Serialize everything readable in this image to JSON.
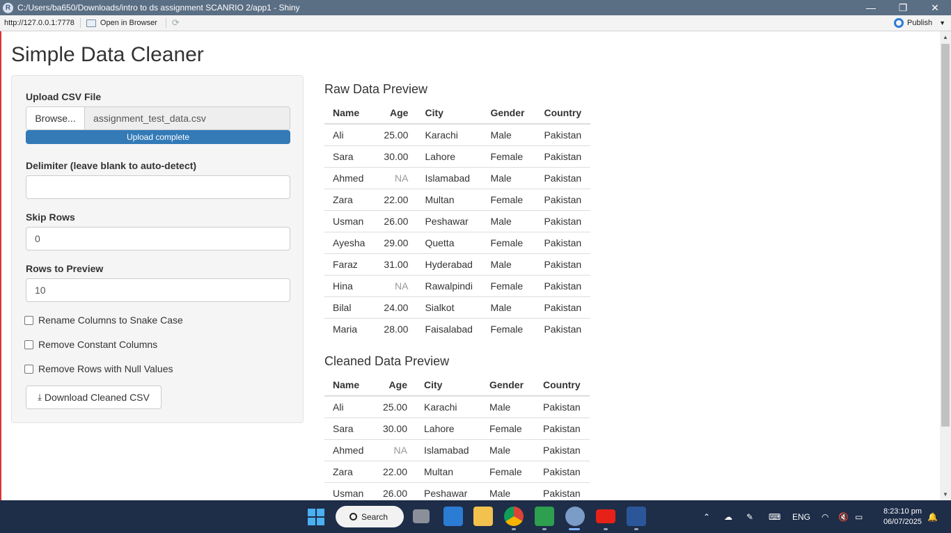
{
  "window": {
    "title": "C:/Users/ba650/Downloads/intro to ds assignment SCANRIO 2/app1 - Shiny",
    "app_icon": "R",
    "minimize": "—",
    "maximize": "❐",
    "close": "✕"
  },
  "toolbar": {
    "url": "http://127.0.0.1:7778",
    "open_in_browser": "Open in Browser",
    "publish": "Publish"
  },
  "page": {
    "title": "Simple Data Cleaner"
  },
  "sidebar": {
    "upload_label": "Upload CSV File",
    "browse_label": "Browse...",
    "file_name": "assignment_test_data.csv",
    "upload_status": "Upload complete",
    "delimiter_label": "Delimiter (leave blank to auto-detect)",
    "delimiter_value": "",
    "skip_rows_label": "Skip Rows",
    "skip_rows_value": "0",
    "rows_preview_label": "Rows to Preview",
    "rows_preview_value": "10",
    "checkboxes": [
      {
        "label": "Rename Columns to Snake Case",
        "checked": false
      },
      {
        "label": "Remove Constant Columns",
        "checked": false
      },
      {
        "label": "Remove Rows with Null Values",
        "checked": false
      }
    ],
    "download_label": "Download Cleaned CSV"
  },
  "raw_preview": {
    "title": "Raw Data Preview",
    "columns": [
      "Name",
      "Age",
      "City",
      "Gender",
      "Country"
    ],
    "rows": [
      [
        "Ali",
        "25.00",
        "Karachi",
        "Male",
        "Pakistan"
      ],
      [
        "Sara",
        "30.00",
        "Lahore",
        "Female",
        "Pakistan"
      ],
      [
        "Ahmed",
        "NA",
        "Islamabad",
        "Male",
        "Pakistan"
      ],
      [
        "Zara",
        "22.00",
        "Multan",
        "Female",
        "Pakistan"
      ],
      [
        "Usman",
        "26.00",
        "Peshawar",
        "Male",
        "Pakistan"
      ],
      [
        "Ayesha",
        "29.00",
        "Quetta",
        "Female",
        "Pakistan"
      ],
      [
        "Faraz",
        "31.00",
        "Hyderabad",
        "Male",
        "Pakistan"
      ],
      [
        "Hina",
        "NA",
        "Rawalpindi",
        "Female",
        "Pakistan"
      ],
      [
        "Bilal",
        "24.00",
        "Sialkot",
        "Male",
        "Pakistan"
      ],
      [
        "Maria",
        "28.00",
        "Faisalabad",
        "Female",
        "Pakistan"
      ]
    ]
  },
  "cleaned_preview": {
    "title": "Cleaned Data Preview",
    "columns": [
      "Name",
      "Age",
      "City",
      "Gender",
      "Country"
    ],
    "rows": [
      [
        "Ali",
        "25.00",
        "Karachi",
        "Male",
        "Pakistan"
      ],
      [
        "Sara",
        "30.00",
        "Lahore",
        "Female",
        "Pakistan"
      ],
      [
        "Ahmed",
        "NA",
        "Islamabad",
        "Male",
        "Pakistan"
      ],
      [
        "Zara",
        "22.00",
        "Multan",
        "Female",
        "Pakistan"
      ],
      [
        "Usman",
        "26.00",
        "Peshawar",
        "Male",
        "Pakistan"
      ]
    ]
  },
  "taskbar": {
    "search_label": "Search",
    "language": "ENG",
    "time": "8:23:10 pm",
    "date": "06/07/2025",
    "apps": [
      "file-explorer-icon",
      "store-icon",
      "folder-icon",
      "chrome-icon",
      "slides-icon",
      "r-icon",
      "youtube-icon",
      "word-icon"
    ]
  },
  "colors": {
    "titlebar": "#5a6e84",
    "progress": "#337ab7",
    "taskbar": "#1e2d48"
  }
}
